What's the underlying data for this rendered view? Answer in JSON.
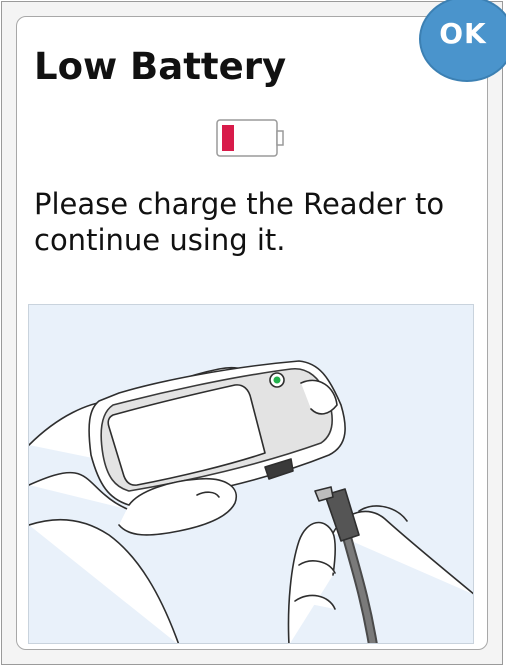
{
  "dialog": {
    "title": "Low Battery",
    "message": "Please charge the Reader to continue using it.",
    "ok_label": "OK"
  },
  "battery": {
    "level": 0.15,
    "status": "low",
    "fill_color": "#d81b4a"
  },
  "icons": {
    "battery": "battery-low-icon"
  },
  "colors": {
    "ok_button": "#4a94cc",
    "illustration_background": "#e9f1fa"
  }
}
